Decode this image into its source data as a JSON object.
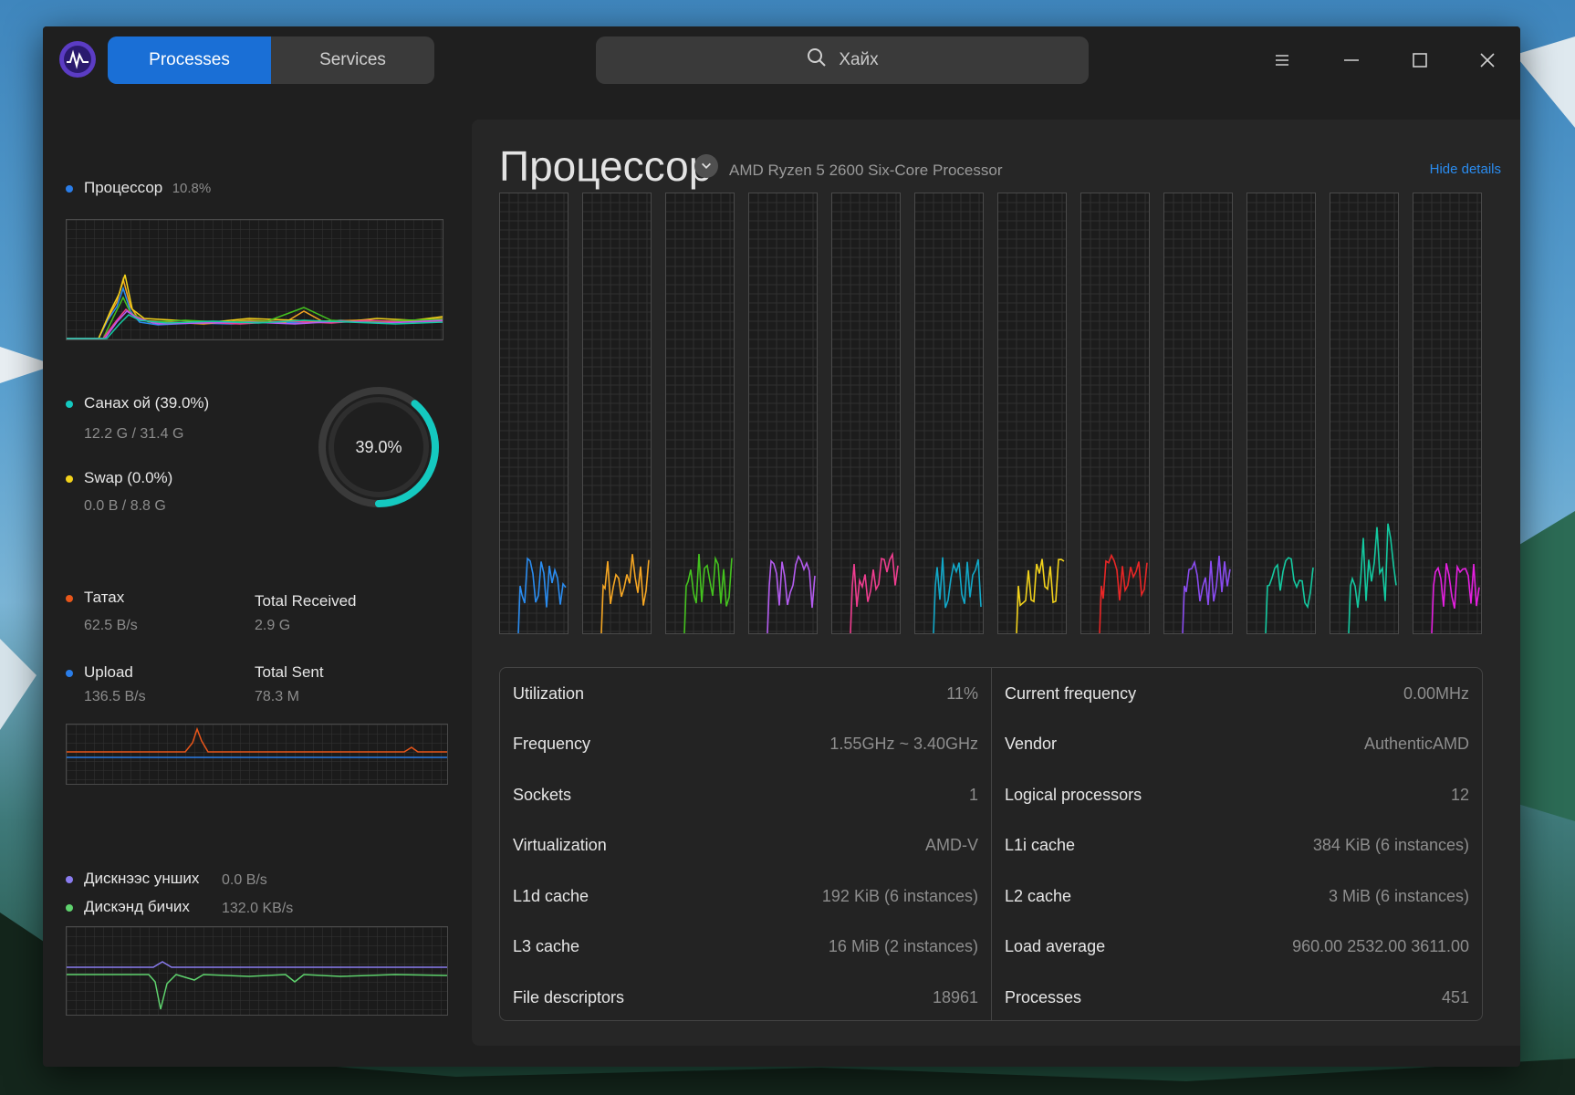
{
  "tabs": [
    "Processes",
    "Services"
  ],
  "search": {
    "placeholder": "Хайх"
  },
  "colors": {
    "accent": "#1a6fd6",
    "link": "#2a8cf0"
  },
  "sidebar": {
    "cpu": {
      "label": "Процессор",
      "value": "10.8%"
    },
    "memory": {
      "ram_label": "Санах ой (39.0%)",
      "ram_value": "12.2 G / 31.4 G",
      "swap_label": "Swap (0.0%)",
      "swap_value": "0.0 B / 8.8 G",
      "donut_percent": "39.0%",
      "donut_fraction": 0.39
    },
    "network": {
      "download_label": "Татах",
      "download_value": "62.5 B/s",
      "total_received_label": "Total Received",
      "total_received_value": "2.9 G",
      "upload_label": "Upload",
      "upload_value": "136.5 B/s",
      "total_sent_label": "Total Sent",
      "total_sent_value": "78.3 M"
    },
    "disk": {
      "read_label": "Дискнээс унших",
      "read_value": "0.0 B/s",
      "write_label": "Дискэнд бичих",
      "write_value": "132.0 KB/s"
    }
  },
  "main": {
    "title": "Процессор",
    "model": "AMD Ryzen 5 2600 Six-Core Processor",
    "hide_details": "Hide details",
    "core_colors": [
      "#2a8cf0",
      "#f5a623",
      "#44c21f",
      "#b45cf0",
      "#ef3d8f",
      "#12a8c8",
      "#f2d21b",
      "#e82626",
      "#8a4cf0",
      "#14c9a0",
      "#14c9a0",
      "#e520e0"
    ],
    "info_left": [
      {
        "k": "Utilization",
        "v": "11%"
      },
      {
        "k": "Frequency",
        "v": "1.55GHz ~ 3.40GHz"
      },
      {
        "k": "Sockets",
        "v": "1"
      },
      {
        "k": "Virtualization",
        "v": "AMD-V"
      },
      {
        "k": "L1d cache",
        "v": "192 KiB (6 instances)"
      },
      {
        "k": "L3 cache",
        "v": "16 MiB (2 instances)"
      },
      {
        "k": "File descriptors",
        "v": "18961"
      }
    ],
    "info_right": [
      {
        "k": "Current frequency",
        "v": "0.00MHz"
      },
      {
        "k": "Vendor",
        "v": "AuthenticAMD"
      },
      {
        "k": "Logical processors",
        "v": "12"
      },
      {
        "k": "L1i cache",
        "v": "384 KiB (6 instances)"
      },
      {
        "k": "L2 cache",
        "v": "3 MiB (6 instances)"
      },
      {
        "k": "Load average",
        "v": "960.00 2532.00 3611.00"
      },
      {
        "k": "Processes",
        "v": "451"
      }
    ]
  }
}
